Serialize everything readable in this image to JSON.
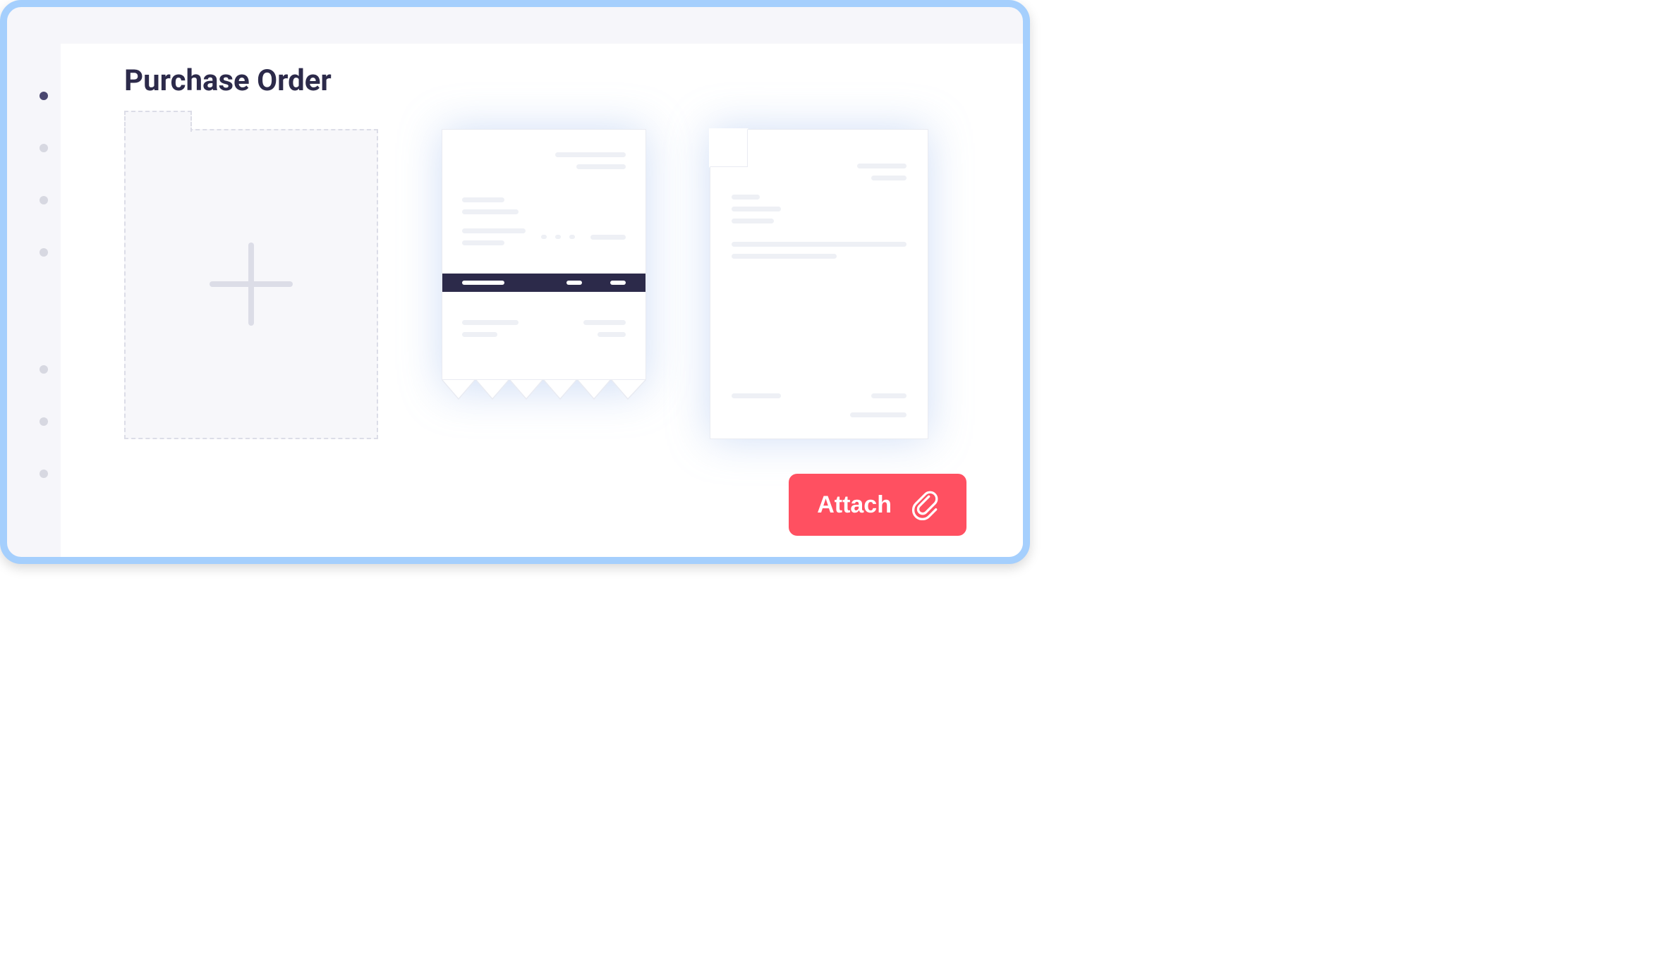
{
  "title": "Purchase Order",
  "attach_label": "Attach",
  "colors": {
    "frame_border": "#A5CFFD",
    "title": "#2C2A4A",
    "accent": "#FF5061",
    "line": "#EEF0F5",
    "stripe": "#2C2A4A"
  },
  "sidebar": {
    "dots": [
      {
        "active": true
      },
      {
        "active": false
      },
      {
        "active": false
      },
      {
        "active": false
      },
      {
        "active": false
      },
      {
        "active": false
      },
      {
        "active": false
      }
    ]
  },
  "tiles": [
    {
      "kind": "add"
    },
    {
      "kind": "receipt"
    },
    {
      "kind": "document"
    }
  ]
}
